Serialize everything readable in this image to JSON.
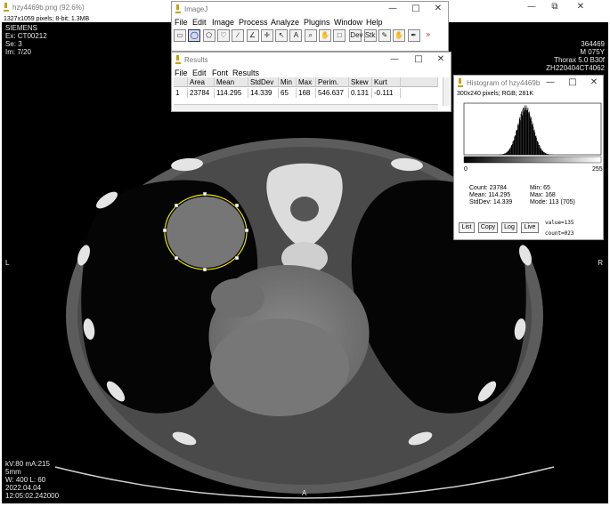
{
  "image_window": {
    "title": "hzy4469b.png (92.6%)",
    "info": "1327x1059 pixels; 8-bit; 1.3MB",
    "controls": {
      "minimize": "—",
      "maximize": "⧉",
      "close": "✕"
    }
  },
  "overlay": {
    "top_left": [
      "SIEMENS",
      "Ex: CT00212",
      "Se: 3",
      "Im: 7/20"
    ],
    "top_right": [
      "364469",
      "M 075Y",
      "Thorax  5.0  B30f",
      "ZH220404CT4062"
    ],
    "bottom_left": [
      "kV:80 mA:215",
      "5mm",
      "W: 400 L: 60",
      "2022.04.04",
      "12:05:02.242000"
    ],
    "left_marker": "L",
    "right_marker": "R",
    "bottom_marker": "A"
  },
  "imagej": {
    "title": "ImageJ",
    "menu": [
      "File",
      "Edit",
      "Image",
      "Process",
      "Analyze",
      "Plugins",
      "Window",
      "Help"
    ],
    "tools": [
      {
        "name": "rectangle-tool",
        "glyph": "▭"
      },
      {
        "name": "oval-tool",
        "glyph": "◯"
      },
      {
        "name": "polygon-tool",
        "glyph": "⬠"
      },
      {
        "name": "freehand-tool",
        "glyph": "♡"
      },
      {
        "name": "line-tool",
        "glyph": "∕"
      },
      {
        "name": "angle-tool",
        "glyph": "∠"
      },
      {
        "name": "point-tool",
        "glyph": "✛"
      },
      {
        "name": "wand-tool",
        "glyph": "↖"
      },
      {
        "name": "text-tool",
        "glyph": "A"
      },
      {
        "name": "magnifier-tool",
        "glyph": "⌕"
      },
      {
        "name": "hand-tool",
        "glyph": "✋"
      },
      {
        "name": "color-picker-tool",
        "glyph": "□"
      },
      {
        "name": "developer-menu-tool",
        "glyph": "Dev"
      },
      {
        "name": "stack-tool",
        "glyph": "Stk"
      },
      {
        "name": "pencil-tool",
        "glyph": "✎"
      },
      {
        "name": "brush-tool",
        "glyph": "✋"
      },
      {
        "name": "dropper-tool",
        "glyph": "✒"
      },
      {
        "name": "more-tools",
        "glyph": "»"
      }
    ]
  },
  "results": {
    "title": "Results",
    "menu": [
      "File",
      "Edit",
      "Font",
      "Results"
    ],
    "columns": [
      "",
      "Area",
      "Mean",
      "StdDev",
      "Min",
      "Max",
      "Perim.",
      "Skew",
      "Kurt"
    ],
    "rows": [
      [
        "1",
        "23784",
        "114.295",
        "14.339",
        "65",
        "168",
        "546.637",
        "0.131",
        "-0.111"
      ]
    ]
  },
  "histogram": {
    "title": "Histogram of hzy4469b",
    "subtitle": "300x240 pixels; RGB; 281K",
    "axis_min": "0",
    "axis_max": "255",
    "stats_left": [
      "Count: 23784",
      "Mean: 114.295",
      "StdDev: 14.339"
    ],
    "stats_right": [
      "Min: 65",
      "Max: 168",
      "Mode: 113 (705)"
    ],
    "buttons": [
      "List",
      "Copy",
      "Log",
      "Live"
    ],
    "value_readout": "value=135",
    "count_readout": "count=023",
    "chart_data": {
      "type": "bar",
      "x_range": [
        0,
        255
      ],
      "min": 65,
      "max": 168,
      "mean": 114.295,
      "stddev": 14.339,
      "mode": 113,
      "mode_count": 705
    }
  }
}
